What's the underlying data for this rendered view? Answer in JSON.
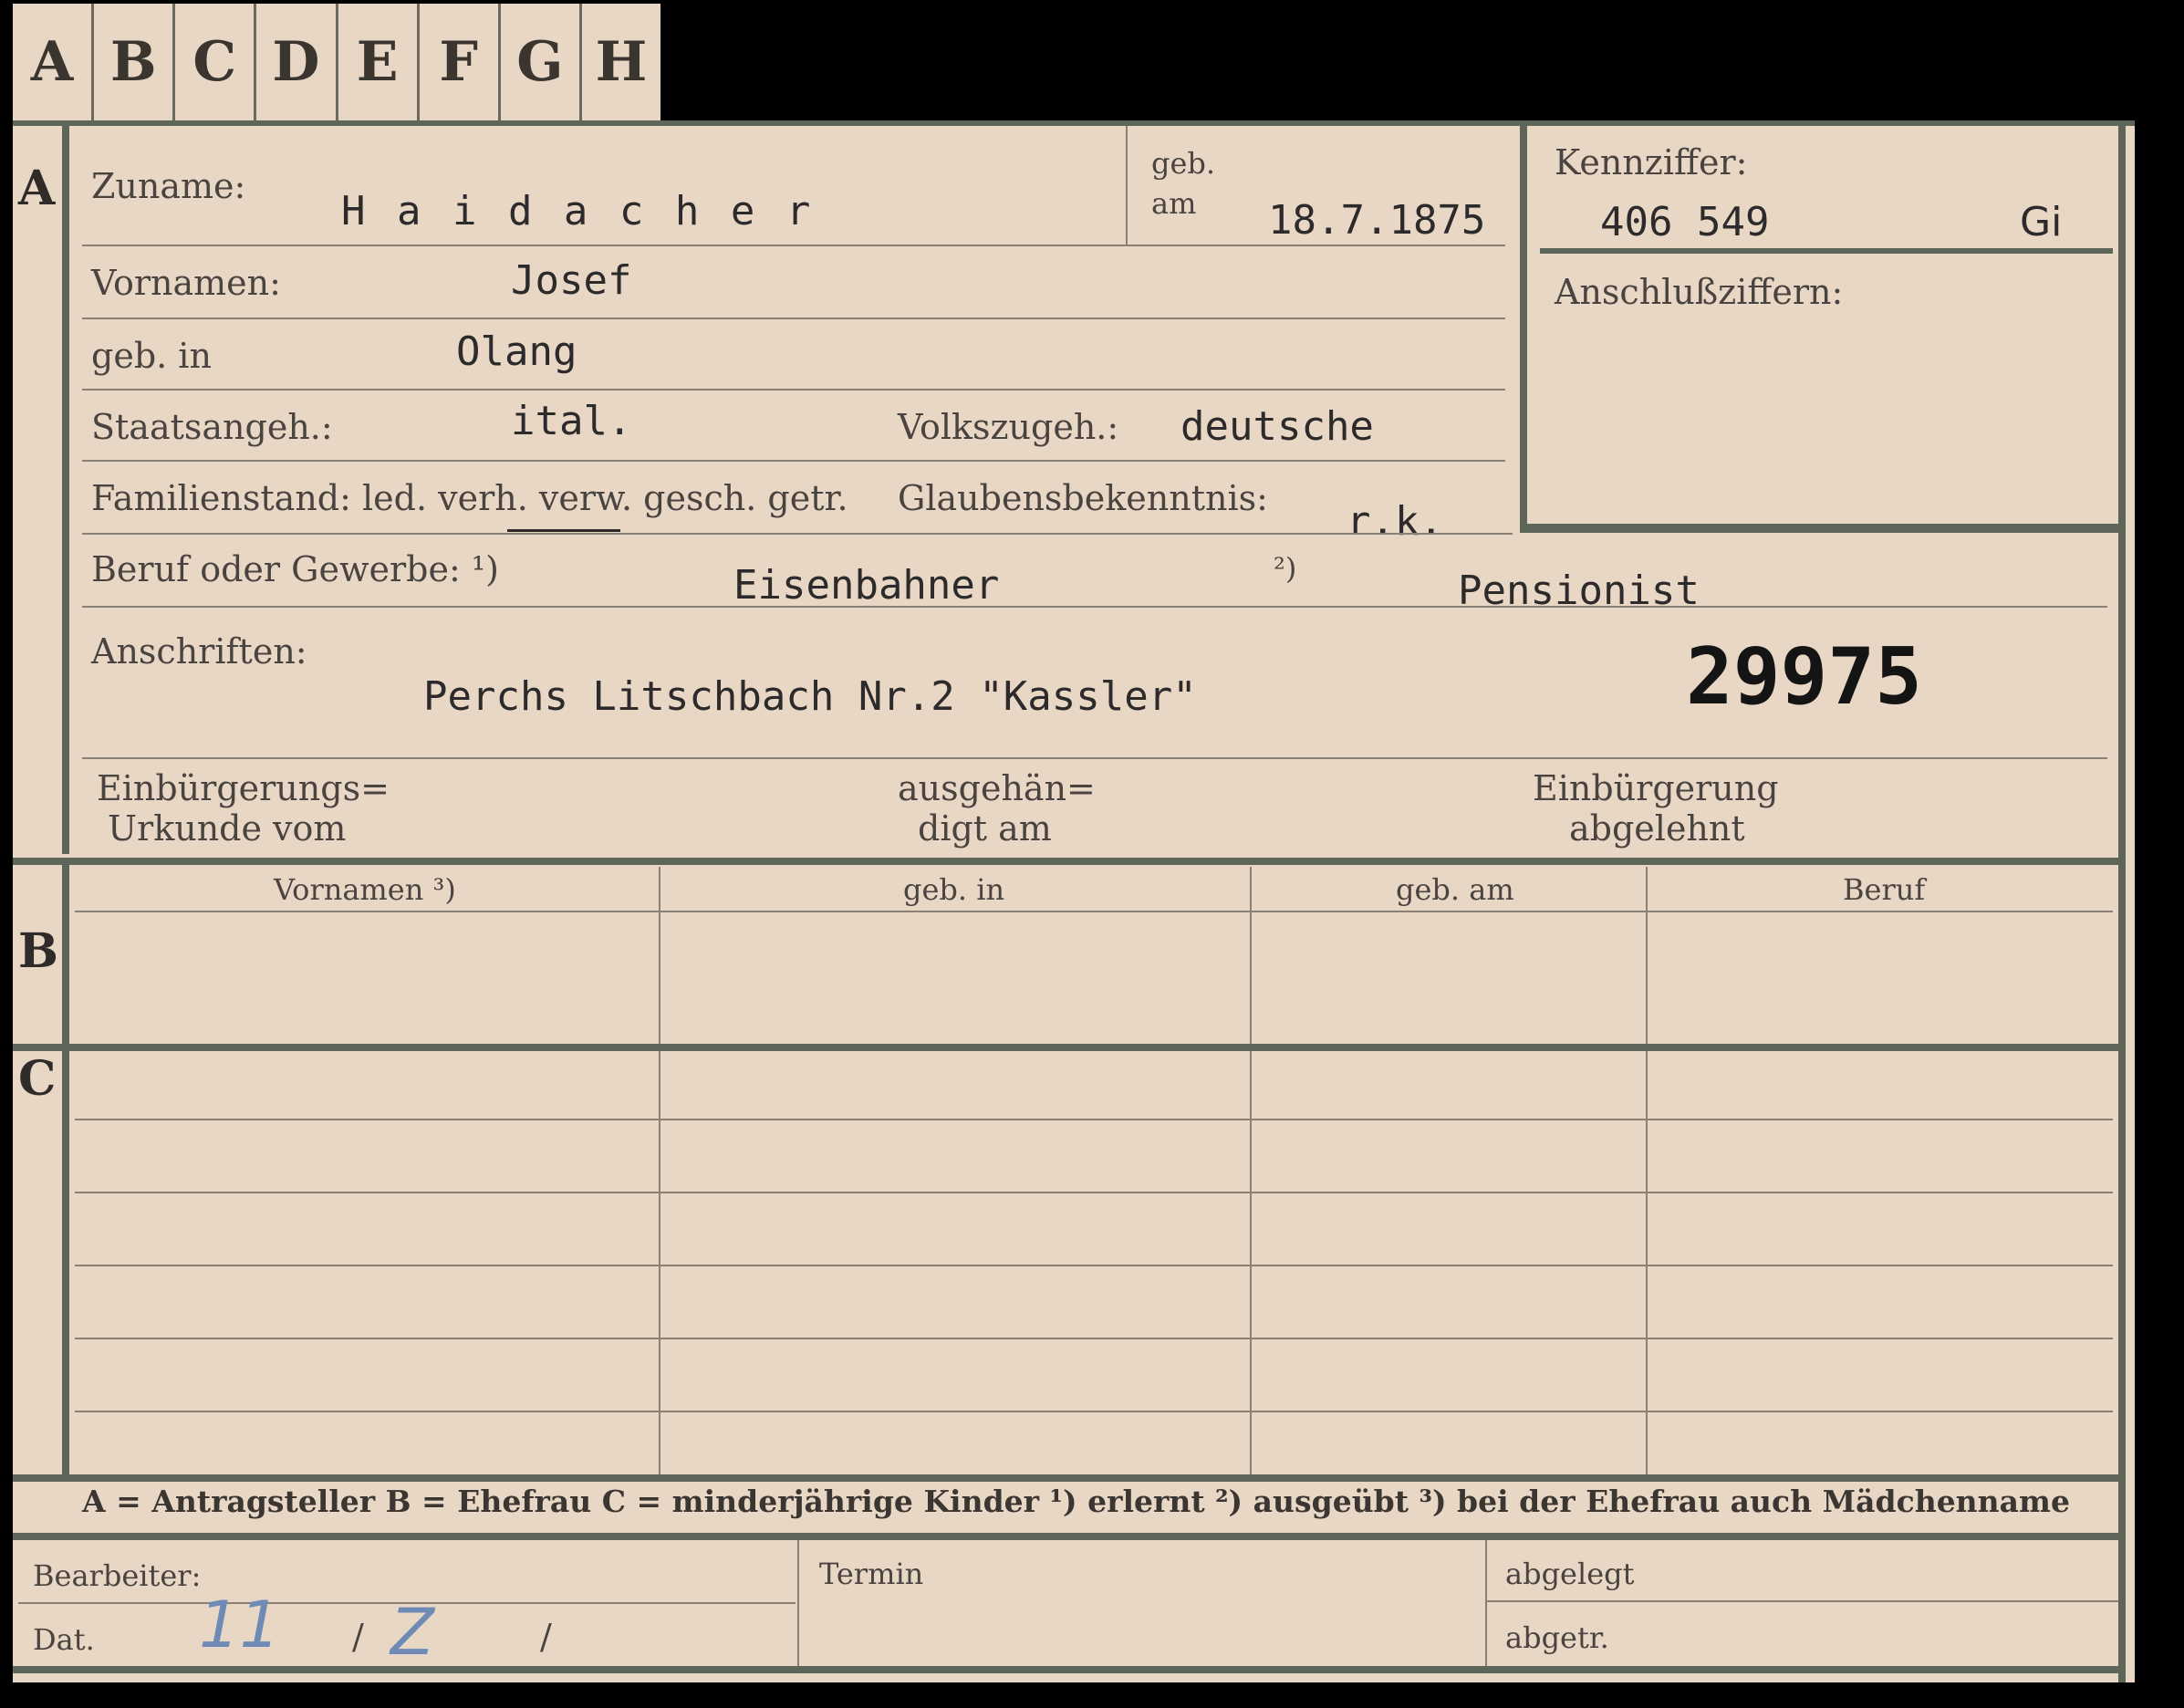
{
  "tabs": [
    "A",
    "B",
    "C",
    "D",
    "E",
    "F",
    "G",
    "H"
  ],
  "section_a": {
    "letter": "A",
    "zuname_label": "Zuname:",
    "zuname_value": "H a i d a c h e r",
    "geb_label_1": "geb.",
    "geb_label_2": "am",
    "geb_am_value": "18.7.1875",
    "vornamen_label": "Vornamen:",
    "vornamen_value": "Josef",
    "geb_in_label": "geb. in",
    "geb_in_value": "Olang",
    "staatsangeh_label": "Staatsangeh.:",
    "staatsangeh_value": "ital.",
    "volkszugeh_label": "Volkszugeh.:",
    "volkszugeh_value": "deutsche",
    "familienstand_label": "Familienstand: led. verh. verw. gesch. getr.",
    "glaubens_label": "Glaubensbekenntnis:",
    "glaubens_value": "r.k.",
    "beruf_label": "Beruf oder Gewerbe: ¹)",
    "beruf_value_1": "Eisenbahner",
    "beruf_note_2": "²)",
    "beruf_value_2": "Pensionist",
    "anschriften_label": "Anschriften:",
    "anschriften_value": "Perchs  Litschbach  Nr.2 \"Kassler\"",
    "stamp_number": "29975",
    "einb_label_1": "Einbürgerungs=",
    "einb_label_2": "Urkunde vom",
    "ausgeh_label_1": "ausgehän=",
    "ausgeh_label_2": "digt am",
    "abgelehnt_label_1": "Einbürgerung",
    "abgelehnt_label_2": "abgelehnt"
  },
  "kennziffer": {
    "label": "Kennziffer:",
    "value": "406 549",
    "suffix": "Gi",
    "anschluss_label": "Anschlußziffern:"
  },
  "section_b": {
    "letter": "B",
    "columns": [
      "Vornamen ³)",
      "geb. in",
      "geb. am",
      "Beruf"
    ]
  },
  "section_c": {
    "letter": "C"
  },
  "legend": "A = Antragsteller   B = Ehefrau   C = minderjährige Kinder   ¹) erlernt   ²) ausgeübt   ³) bei der Ehefrau auch Mädchenname",
  "footer": {
    "bearbeiter_label": "Bearbeiter:",
    "dat_label": "Dat.",
    "dat_value_1": "11",
    "dat_slash_1": "/",
    "dat_value_2": "Z",
    "dat_slash_2": "/",
    "termin_label": "Termin",
    "abgelegt_label": "abgelegt",
    "abgetr_label": "abgetr."
  },
  "colors": {
    "card": "#e9d7c6",
    "rule": "#5d6659",
    "background": "#000000",
    "ink": "#2c2a2a",
    "pencil_blue": "#6f8ab5"
  }
}
